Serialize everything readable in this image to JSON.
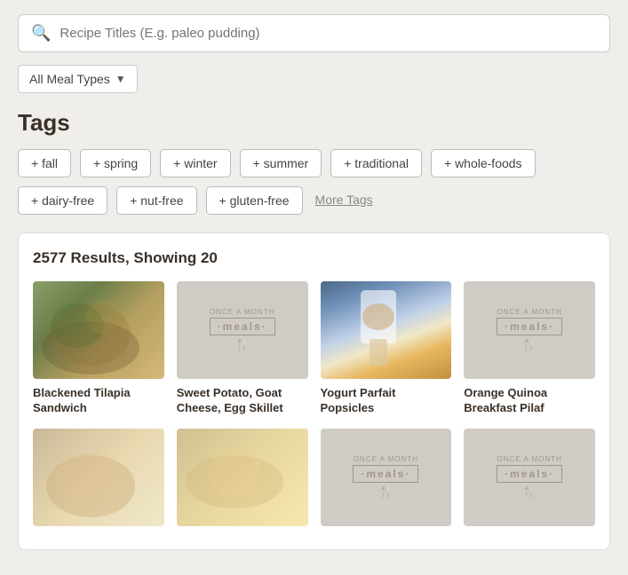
{
  "search": {
    "placeholder": "Recipe Titles (E.g. paleo pudding)"
  },
  "mealType": {
    "label": "All Meal Types",
    "arrow": "▼"
  },
  "tags": {
    "title": "Tags",
    "items": [
      "+ fall",
      "+ spring",
      "+ winter",
      "+ summer",
      "+ traditional",
      "+ whole-foods",
      "+ dairy-free",
      "+ nut-free",
      "+ gluten-free"
    ],
    "more_label": "More Tags"
  },
  "results": {
    "count_label": "2577 Results, Showing 20",
    "recipes": [
      {
        "title": "Blackened Tilapia Sandwich",
        "has_image": true,
        "img_class": "food-img-1"
      },
      {
        "title": "Sweet Potato, Goat Cheese, Egg Skillet",
        "has_image": false
      },
      {
        "title": "Yogurt Parfait Popsicles",
        "has_image": true,
        "img_class": "food-img-3"
      },
      {
        "title": "Orange Quinoa Breakfast Pilaf",
        "has_image": false
      },
      {
        "title": "",
        "has_image": true,
        "img_class": "food-img-5"
      },
      {
        "title": "",
        "has_image": true,
        "img_class": "food-img-6"
      },
      {
        "title": "",
        "has_image": false
      },
      {
        "title": "",
        "has_image": false
      }
    ],
    "placeholder_logo_top": "once a month",
    "placeholder_logo_middle": "·meals·",
    "placeholder_logo_icon": "🍴"
  }
}
